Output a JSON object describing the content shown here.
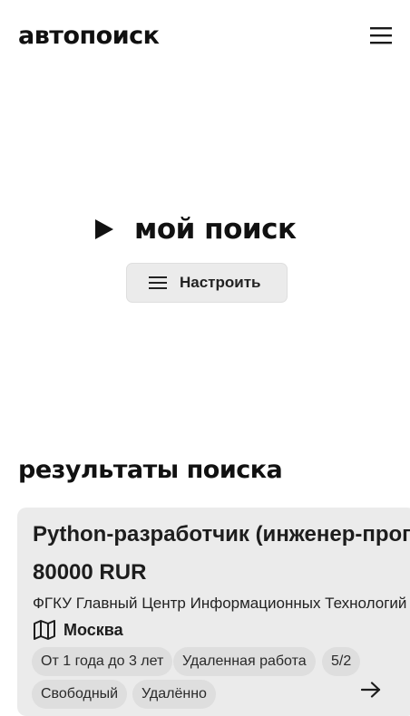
{
  "header": {
    "logo": "автопоиск",
    "menu_icon": "hamburger-icon"
  },
  "hero": {
    "play_icon": "play-icon",
    "title": "мой поиск",
    "configure_button": {
      "icon": "hamburger-icon",
      "label": "Настроить"
    }
  },
  "results": {
    "title": "результаты поиска",
    "cards": [
      {
        "title": "Python-разработчик (инженер-программист)",
        "salary": "80000 RUR",
        "company": "ФГКУ Главный Центр Информационных Технологий",
        "city_icon": "map-icon",
        "city": "Москва",
        "tags": [
          "От 1 года до 3 лет",
          "Удаленная работа",
          "5/2",
          "Свободный",
          "Удалённо"
        ],
        "open_icon": "arrow-right-icon"
      }
    ]
  }
}
